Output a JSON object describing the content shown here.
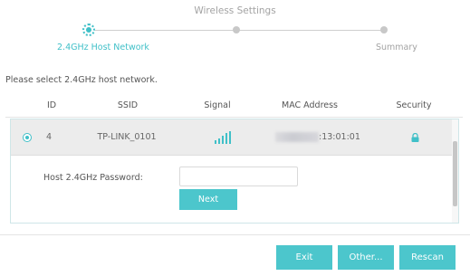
{
  "wizard": {
    "title": "Wireless Settings",
    "steps": [
      {
        "label": "2.4GHz Host Network",
        "state": "current"
      },
      {
        "label": "",
        "state": "pending"
      },
      {
        "label": "Summary",
        "state": "pending"
      }
    ]
  },
  "instruction": "Please select 2.4GHz host network.",
  "table": {
    "columns": [
      "ID",
      "SSID",
      "Signal",
      "MAC Address",
      "Security"
    ],
    "rows": [
      {
        "selected": true,
        "id": "4",
        "ssid": "TP-LINK_0101",
        "signal_bars": 5,
        "mac_visible_suffix": ":13:01:01",
        "security_icon": "lock-icon"
      }
    ]
  },
  "password": {
    "label": "Host 2.4GHz Password:",
    "value": "",
    "placeholder": ""
  },
  "buttons": {
    "next": "Next",
    "exit": "Exit",
    "other": "Other...",
    "rescan": "Rescan"
  },
  "colors": {
    "accent": "#4cc6cc",
    "selected_row": "#ececec"
  }
}
